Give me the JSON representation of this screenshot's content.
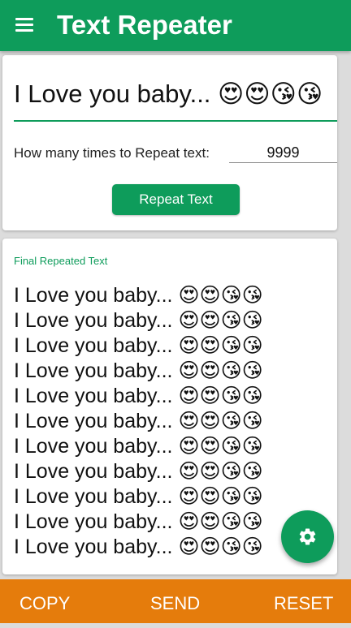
{
  "app": {
    "title": "Text Repeater",
    "accent_color": "#0e9c5b",
    "bottom_bar_color": "#e57c0c"
  },
  "header": {
    "menu_icon": "menu-icon"
  },
  "input": {
    "text_value": "I Love you baby... 😍😍😘😘",
    "repeat_label": "How many times to Repeat text:",
    "repeat_count": "9999",
    "repeat_button": "Repeat Text"
  },
  "output": {
    "label": "Final Repeated Text",
    "lines": [
      "I Love you baby... 😍😍😘😘",
      "I Love you baby... 😍😍😘😘",
      "I Love you baby... 😍😍😘😘",
      "I Love you baby... 😍😍😘😘",
      "I Love you baby... 😍😍😘😘",
      "I Love you baby... 😍😍😘😘",
      "I Love you baby... 😍😍😘😘",
      "I Love you baby... 😍😍😘😘",
      "I Love you baby... 😍😍😘😘",
      "I Love you baby... 😍😍😘😘",
      "I Love you baby... 😍😍😘😘"
    ]
  },
  "fab": {
    "icon": "gear-icon"
  },
  "bottom_bar": {
    "copy": "COPY",
    "send": "SEND",
    "reset": "RESET"
  }
}
